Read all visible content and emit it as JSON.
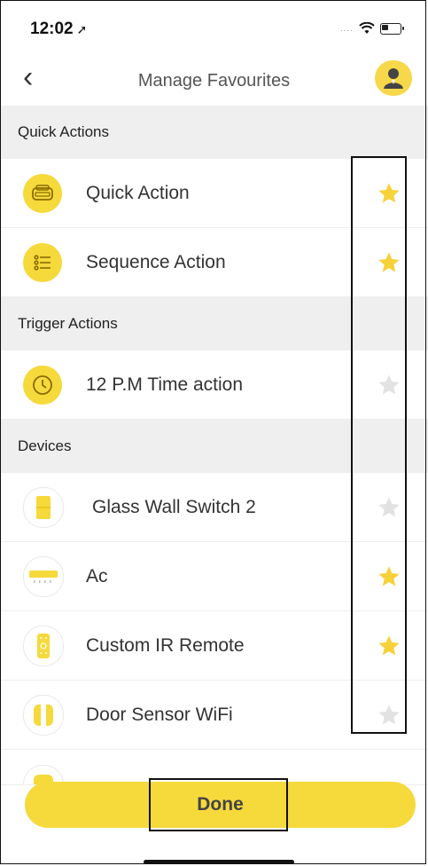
{
  "status_bar": {
    "time": "12:02",
    "signal": "....",
    "time_arrow": "➚"
  },
  "nav": {
    "back_icon": "‹",
    "title": "Manage Favourites",
    "avatar_icon": "user-avatar-icon"
  },
  "sections": [
    {
      "title": "Quick Actions",
      "items": [
        {
          "label": "Quick Action",
          "icon": "car-icon",
          "favourite": true
        },
        {
          "label": "Sequence Action",
          "icon": "list-icon",
          "favourite": true
        }
      ]
    },
    {
      "title": "Trigger Actions",
      "items": [
        {
          "label": "12 P.M Time action",
          "icon": "clock-icon",
          "favourite": false
        }
      ]
    },
    {
      "title": "Devices",
      "items": [
        {
          "label": "Glass Wall Switch 2",
          "icon": "wall-switch-icon",
          "favourite": false
        },
        {
          "label": "Ac",
          "icon": "air-conditioner-icon",
          "favourite": true
        },
        {
          "label": "Custom IR Remote",
          "icon": "remote-icon",
          "favourite": true
        },
        {
          "label": "Door Sensor WiFi",
          "icon": "door-sensor-icon",
          "favourite": false
        }
      ]
    }
  ],
  "done_label": "Done",
  "colors": {
    "accent": "#f6d93b",
    "star_on": "#f7d13a",
    "star_off": "#e2e2e2",
    "section_bg": "#efefef"
  }
}
